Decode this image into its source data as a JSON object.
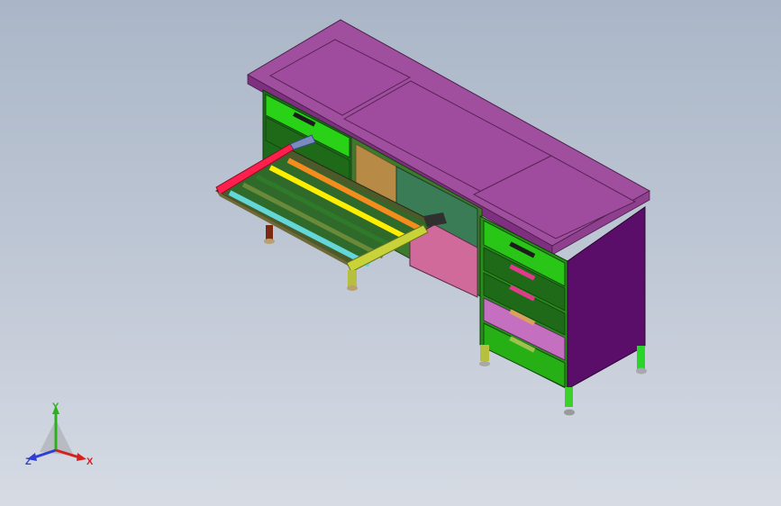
{
  "viewport": {
    "background_top": "#aab6c7",
    "background_bottom": "#d6dbe4"
  },
  "model": {
    "top_color": "#a04f9e",
    "side_panel_color": "#5a0d69",
    "drawer_green": "#27c60f",
    "drawer_dark": "#1e6a19",
    "drawer_pink": "#c46fc0",
    "slide_out_rack": {
      "rail_colors": [
        "#ff1f4c",
        "#ffee00",
        "#f68c1e",
        "#9c9a10",
        "#63d7d7",
        "#5a5a5a"
      ],
      "handle_color": "#c8d33a"
    }
  },
  "triad": {
    "y_label": "Y",
    "x_label": "X",
    "z_label": "Z",
    "y_color": "#2cb11d",
    "x_color": "#d42020",
    "z_color": "#2f3fd6"
  }
}
